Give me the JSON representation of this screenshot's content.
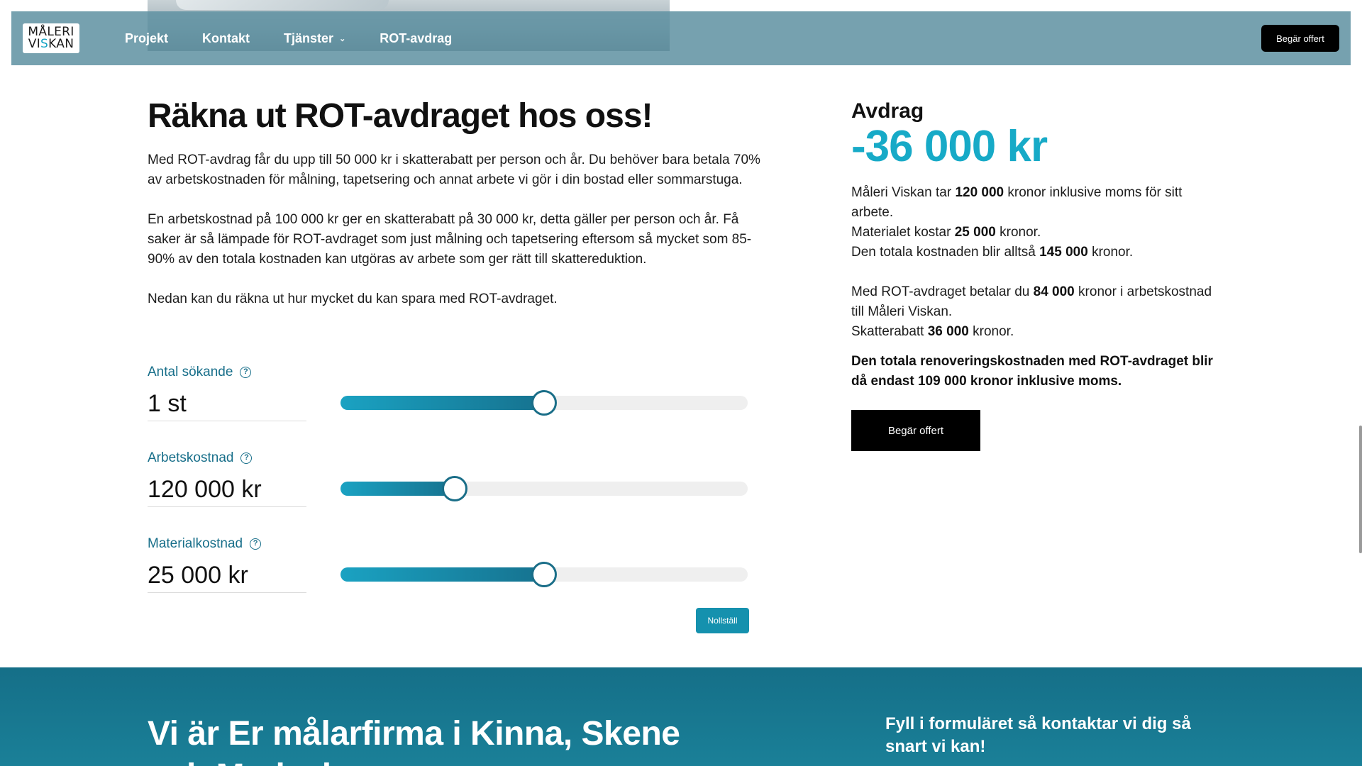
{
  "navbar": {
    "logo_line1": "MÅLERI",
    "logo_line2_a": "VI",
    "logo_line2_b": "S",
    "logo_line2_c": "KAN",
    "links": [
      {
        "label": "Projekt"
      },
      {
        "label": "Kontakt"
      },
      {
        "label": "Tjänster",
        "icon": "chevron-down-icon"
      },
      {
        "label": "ROT-avdrag"
      }
    ],
    "cta": "Begär offert"
  },
  "main": {
    "heading": "Räkna ut ROT-avdraget hos oss!",
    "paragraphs": [
      "Med ROT-avdrag får du upp till 50 000 kr i skatterabatt per person och år. Du behöver bara betala 70% av arbetskostnaden för målning, tapetsering och annat arbete vi gör i din bostad eller sommarstuga.",
      "En arbetskostnad på 100 000 kr ger en skatterabatt på 30 000 kr, detta gäller per person och år. Få saker är så lämpade för ROT-avdraget som just målning och tapetsering eftersom så mycket som 85-90% av den totala kostnaden kan utgöras av arbete som ger rätt till skattereduktion.",
      "Nedan kan du räkna ut hur mycket du kan spara med ROT-avdraget."
    ]
  },
  "calculator": {
    "fields": [
      {
        "label": "Antal sökande",
        "value": "1 st",
        "slider_fraction": 0.5
      },
      {
        "label": "Arbetskostnad",
        "value": "120 000 kr",
        "slider_fraction": 0.28
      },
      {
        "label": "Materialkostnad",
        "value": "25 000 kr",
        "slider_fraction": 0.5
      }
    ],
    "reset_label": "Nollställ"
  },
  "result": {
    "label": "Avdrag",
    "amount": "-36 000 kr",
    "line1_pre": "Måleri Viskan tar ",
    "line1_bold": "120 000",
    "line1_post": " kronor inklusive moms för sitt arbete.",
    "line2_pre": "Materialet kostar ",
    "line2_bold": "25 000",
    "line2_post": " kronor.",
    "line3_pre": "Den totala kostnaden blir alltså ",
    "line3_bold": "145 000",
    "line3_post": " kronor.",
    "line4_pre": "Med ROT-avdraget betalar du ",
    "line4_bold": "84 000",
    "line4_post": " kronor i arbetskostnad till Måleri Viskan.",
    "line5_pre": "Skatterabatt ",
    "line5_bold": "36 000",
    "line5_post": " kronor.",
    "summary": "Den totala renoveringskostnaden med ROT-avdraget blir då endast 109 000 kronor inklusive moms.",
    "cta": "Begär offert"
  },
  "footer": {
    "title": "Vi är Er målarfirma i Kinna, Skene och Marks kommun",
    "subtitle": "Fyll i formuläret så kontaktar vi dig så snart vi kan!"
  },
  "colors": {
    "accent": "#17aac7",
    "nav_bg": "#5f91a2",
    "footer_bg": "#156f88",
    "slider_fill": "#16728f"
  }
}
